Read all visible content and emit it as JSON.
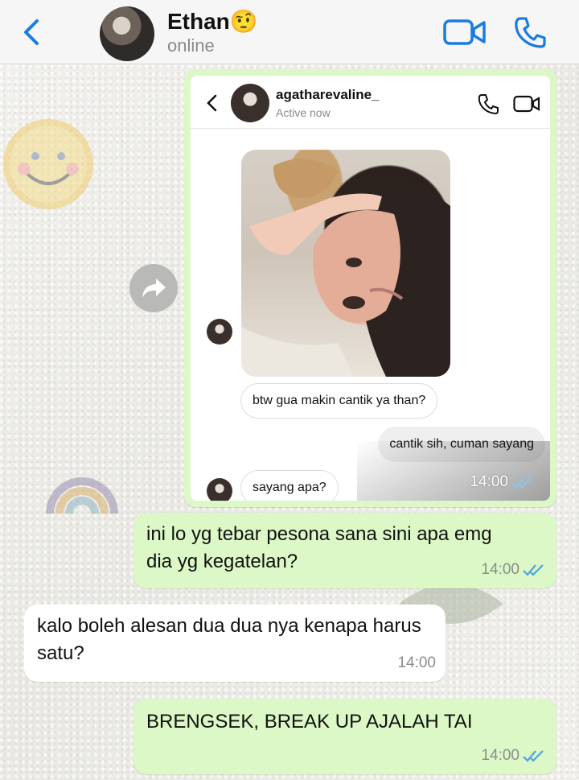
{
  "header": {
    "contact_name": "Ethan🤨",
    "status": "online"
  },
  "forwarded_screenshot": {
    "username": "agatharevaline_",
    "active_status": "Active now",
    "messages": [
      {
        "direction": "in",
        "text": "btw gua makin cantik ya than?"
      },
      {
        "direction": "out",
        "text": "cantik sih, cuman sayang"
      },
      {
        "direction": "in",
        "text": "sayang apa?"
      }
    ],
    "time": "14:00"
  },
  "messages": [
    {
      "direction": "out",
      "text": "ini lo yg tebar pesona sana sini apa emg dia yg kegatelan?",
      "time": "14:00"
    },
    {
      "direction": "in",
      "text": "kalo boleh alesan dua dua nya kenapa harus satu?",
      "time": "14:00"
    },
    {
      "direction": "out",
      "text": "BRENGSEK, BREAK UP AJALAH TAI",
      "time": "14:00"
    }
  ],
  "colors": {
    "accent": "#1a7ce0",
    "outgoing_bubble": "#dcf8c6",
    "incoming_bubble": "#ffffff",
    "read_ticks": "#4fa3e0"
  }
}
